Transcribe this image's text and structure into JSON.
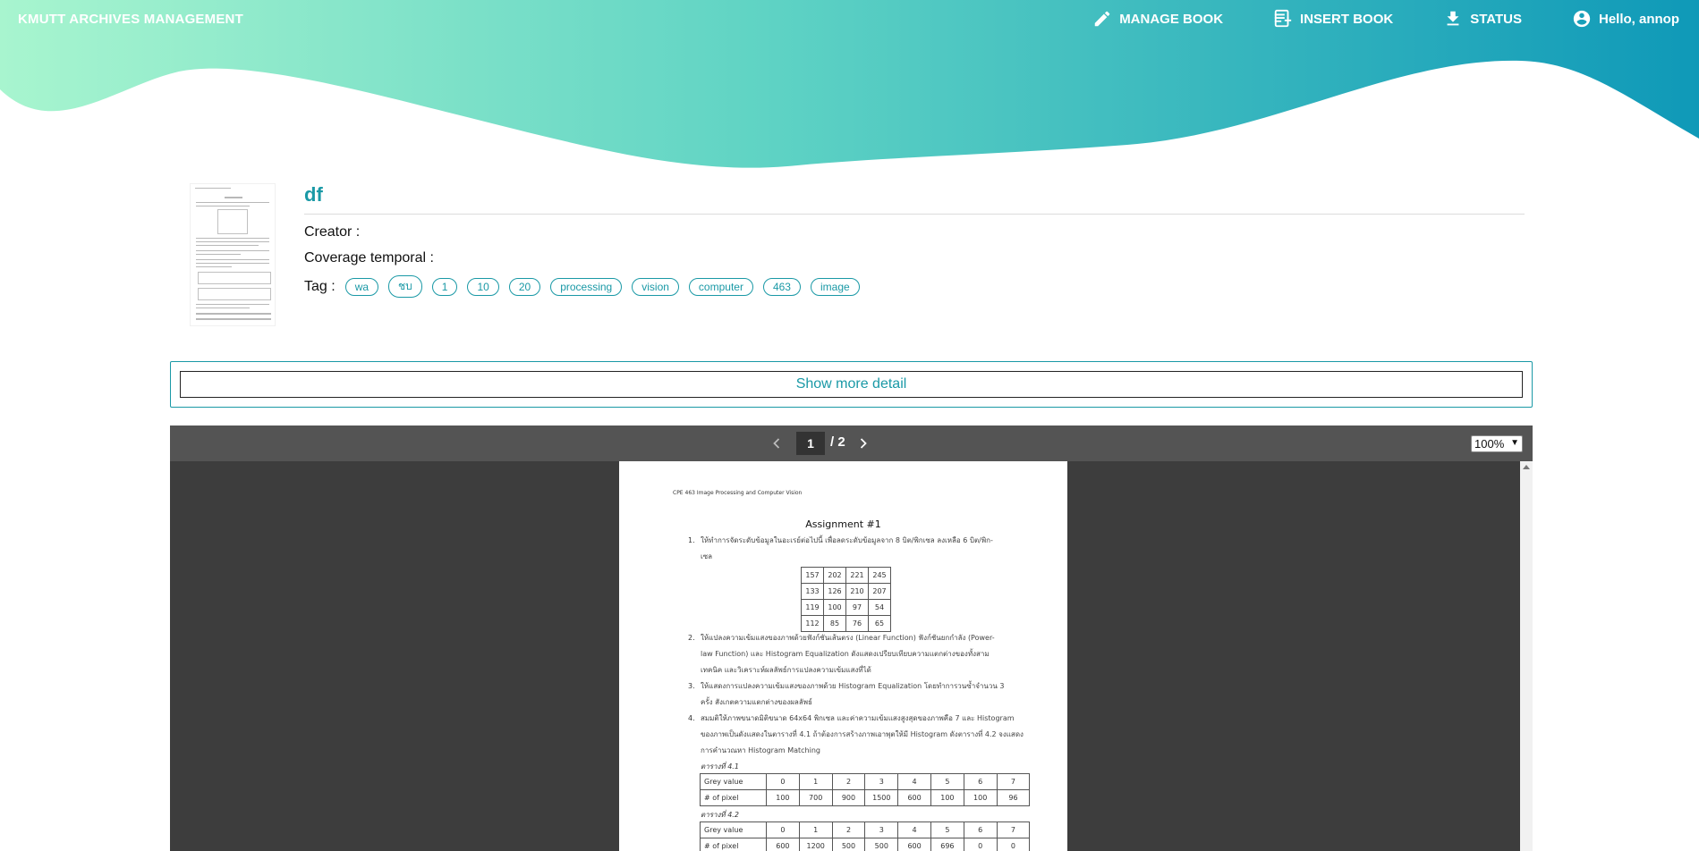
{
  "header": {
    "brand": "KMUTT ARCHIVES MANAGEMENT",
    "nav": {
      "manage_book": "MANAGE BOOK",
      "insert_book": "INSERT BOOK",
      "status": "STATUS",
      "user": "Hello, annop"
    },
    "gradient": [
      "#a8f5cf",
      "#5fd3c4",
      "#0f99b8"
    ]
  },
  "book": {
    "title": "df",
    "creator_label": "Creator :",
    "creator_value": "",
    "coverage_label": "Coverage temporal :",
    "coverage_value": "",
    "tag_label": "Tag :",
    "tags": [
      "wa",
      "ชบ",
      "1",
      "10",
      "20",
      "processing",
      "vision",
      "computer",
      "463",
      "image"
    ]
  },
  "show_more": "Show more detail",
  "viewer": {
    "current_page": "1",
    "total": "/ 2",
    "zoom": "100%"
  },
  "document": {
    "header": "CPE 463 Image Processing and Computer Vision",
    "title": "Assignment #1",
    "q1_num": "1.",
    "q1_line1": "ให้ทำการจัดระดับข้อมูลในอะเรย์ต่อไปนี้ เพื่อลดระดับข้อมูลจาก 8 บิต/พิกเซล ลงเหลือ 6 บิต/พิก-",
    "q1_line2": "เซล",
    "table1": [
      [
        "157",
        "202",
        "221",
        "245"
      ],
      [
        "133",
        "126",
        "210",
        "207"
      ],
      [
        "119",
        "100",
        "97",
        "54"
      ],
      [
        "112",
        "85",
        "76",
        "65"
      ]
    ],
    "q2_num": "2.",
    "q2_line1": "ให้แปลงความเข้มแสงของภาพด้วยฟังก์ชันเส้นตรง (Linear Function) ฟังก์ชันยกกำลัง (Power-",
    "q2_line2": "law Function) และ Histogram Equalization ดังแสดงเปรียบเทียบความแตกต่างของทั้งสาม",
    "q2_line3": "เทคนิค และวิเคราะห์ผลลัพธ์การแปลงความเข้มแสงที่ได้",
    "q3_num": "3.",
    "q3_line1": "ให้แสดงการแปลงความเข้มแสงของภาพด้วย Histogram Equalization โดยทำการวนซ้ำจำนวน 3",
    "q3_line2": "ครั้ง สังเกตความแตกต่างของผลลัพธ์",
    "q4_num": "4.",
    "q4_line1": "สมมติให้ภาพขนาดมิติขนาด 64x64 พิกเซล และค่าความเข้มแสงสูงสุดของภาพคือ 7 และ Histogram",
    "q4_line2": "ของภาพเป็นดังแสดงในตารางที่ 4.1 ถ้าต้องการสร้างภาพเอาพุตให้มี Histogram ดังตารางที่ 4.2 จงแสดง",
    "q4_line3": "การคำนวณหา Histogram Matching",
    "cap1": "ตารางที่ 4.1",
    "cap2": "ตารางที่ 4.2",
    "table41": {
      "row1_label": "Grey value",
      "row1": [
        "0",
        "1",
        "2",
        "3",
        "4",
        "5",
        "6",
        "7"
      ],
      "row2_label": "# of pixel",
      "row2": [
        "100",
        "700",
        "900",
        "1500",
        "600",
        "100",
        "100",
        "96"
      ]
    },
    "table42": {
      "row1_label": "Grey value",
      "row1": [
        "0",
        "1",
        "2",
        "3",
        "4",
        "5",
        "6",
        "7"
      ],
      "row2_label": "# of pixel",
      "row2": [
        "600",
        "1200",
        "500",
        "500",
        "600",
        "696",
        "0",
        "0"
      ]
    }
  }
}
